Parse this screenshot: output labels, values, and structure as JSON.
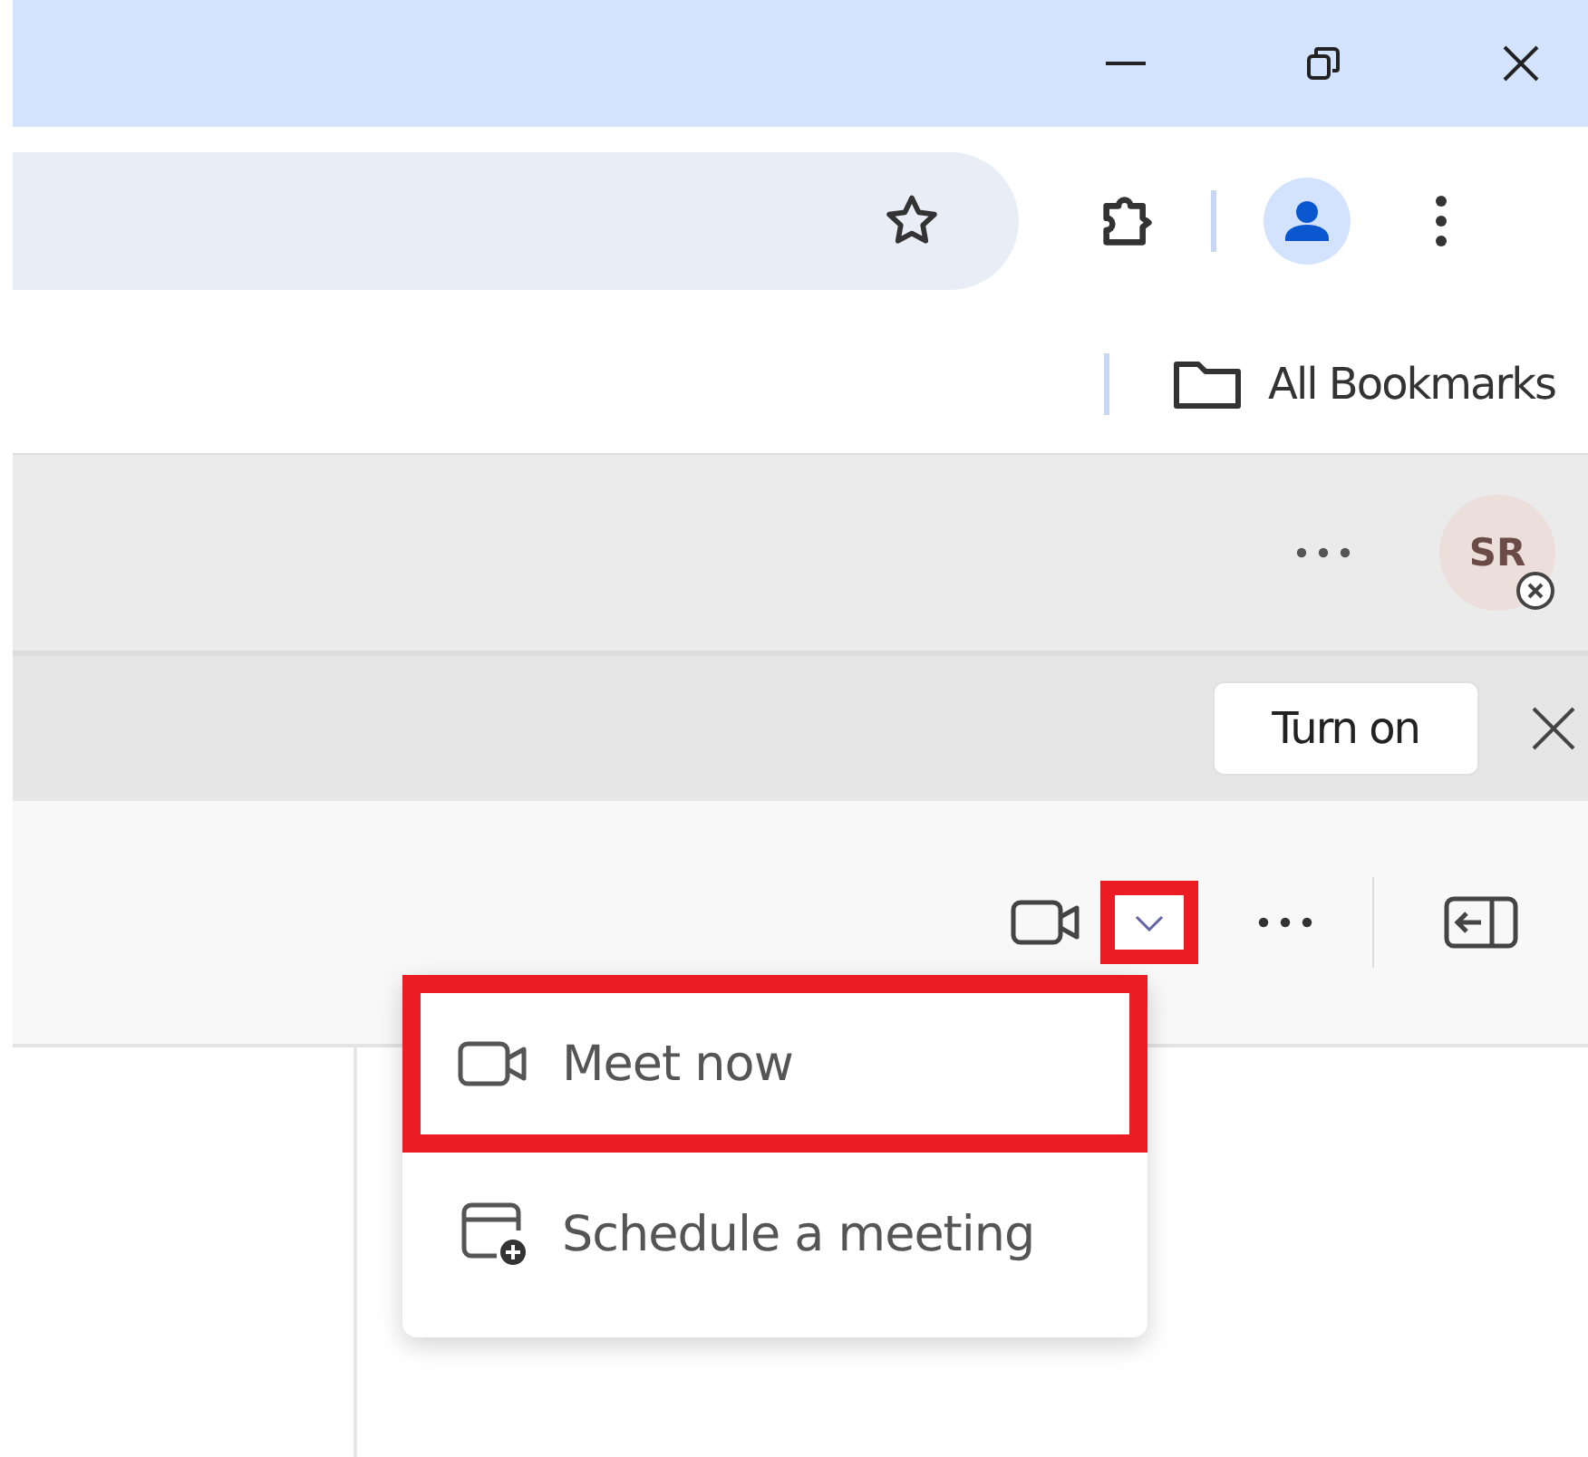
{
  "bookmarks_bar": {
    "label": "All Bookmarks"
  },
  "teams_header": {
    "avatar_initials": "SR"
  },
  "banner": {
    "button": "Turn on"
  },
  "toolbar": {
    "dropdown_highlighted": true
  },
  "menu": {
    "items": [
      {
        "label": "Meet now",
        "kind": "video",
        "highlighted": true
      },
      {
        "label": "Schedule a meeting",
        "kind": "calendar",
        "highlighted": false
      }
    ]
  }
}
